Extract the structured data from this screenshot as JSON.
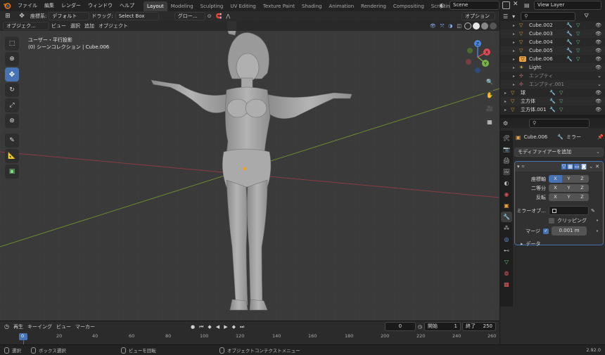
{
  "topbar": {
    "menus": [
      "ファイル",
      "編集",
      "レンダー",
      "ウィンドウ",
      "ヘルプ"
    ],
    "workspaces": [
      "Layout",
      "Modeling",
      "Sculpting",
      "UV Editing",
      "Texture Paint",
      "Shading",
      "Animation",
      "Rendering",
      "Compositing",
      "Scripting"
    ],
    "active_workspace": "Layout",
    "scene": "Scene",
    "view_layer": "View Layer"
  },
  "viewport": {
    "coord_label": "座標系:",
    "coord_value": "デフォルト",
    "drag_label": "ドラッグ:",
    "drag_value": "Select Box",
    "global": "グロー...",
    "options": "オプション",
    "mode": "オブジェク...",
    "menu": [
      "ビュー",
      "選択",
      "追加",
      "オブジェクト"
    ],
    "overlay_title": "ユーザー・平行投影",
    "overlay_subtitle": "(0) シーンコレクション | Cube.006",
    "gizmo": {
      "x": "X",
      "y": "Y",
      "z": "Z"
    }
  },
  "outliner": {
    "search_placeholder": "",
    "items": [
      {
        "name": "Cube.002",
        "indent": 1,
        "type": "mesh"
      },
      {
        "name": "Cube.003",
        "indent": 1,
        "type": "mesh"
      },
      {
        "name": "Cube.004",
        "indent": 1,
        "type": "mesh"
      },
      {
        "name": "Cube.005",
        "indent": 1,
        "type": "mesh"
      },
      {
        "name": "Cube.006",
        "indent": 1,
        "type": "mesh",
        "selected": true
      },
      {
        "name": "Light",
        "indent": 1,
        "type": "light"
      },
      {
        "name": "エンプティ",
        "indent": 1,
        "type": "empty",
        "dim": true
      },
      {
        "name": "エンプティ.001",
        "indent": 1,
        "type": "empty",
        "dim": true
      },
      {
        "name": "球",
        "indent": 0,
        "type": "mesh"
      },
      {
        "name": "立方体",
        "indent": 0,
        "type": "mesh"
      },
      {
        "name": "立方体.001",
        "indent": 0,
        "type": "mesh"
      }
    ]
  },
  "properties": {
    "search_placeholder": "",
    "object_name": "Cube.006",
    "modifier_type": "ミラー",
    "add_modifier": "モディファイアーを追加",
    "rows": {
      "axis": "座標軸",
      "bisect": "二等分",
      "flip": "反転"
    },
    "axes": [
      "X",
      "Y",
      "Z"
    ],
    "mirror_object_label": "ミラーオブ...",
    "clipping": "クリッピング",
    "merge_label": "マージ",
    "merge_value": "0.001 m",
    "data_label": "データ"
  },
  "timeline": {
    "menus": [
      "再生",
      "キーイング",
      "ビュー",
      "マーカー"
    ],
    "current_frame": "0",
    "start_label": "開始",
    "start": "1",
    "end_label": "終了",
    "end": "250",
    "ruler": [
      "0",
      "20",
      "40",
      "60",
      "80",
      "100",
      "120",
      "140",
      "160",
      "180",
      "200",
      "220",
      "240",
      "260"
    ]
  },
  "statusbar": {
    "select": "選択",
    "box_select": "ボックス選択",
    "rotate_view": "ビューを回転",
    "context_menu": "オブジェクトコンテクストメニュー",
    "version": "2.92.0"
  }
}
